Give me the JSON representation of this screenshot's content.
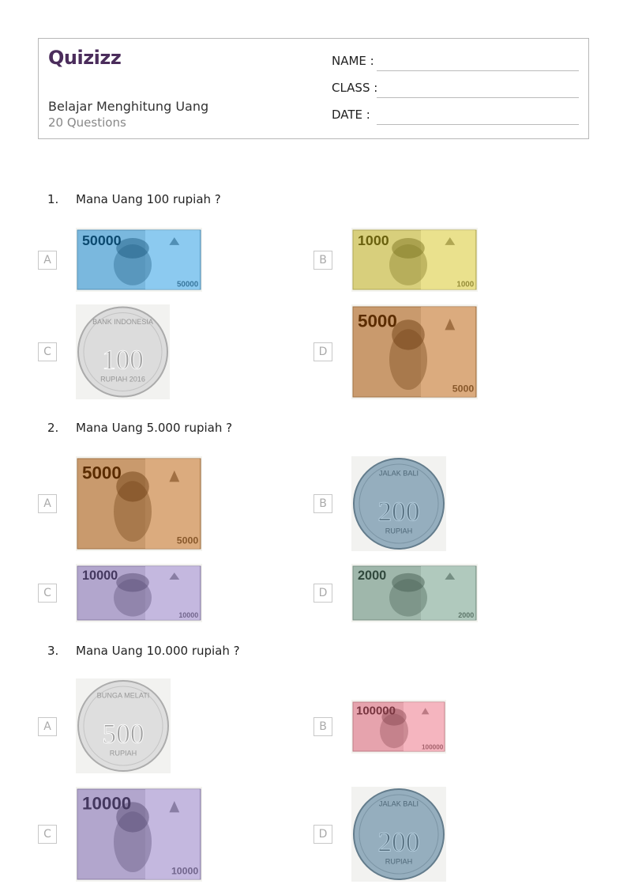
{
  "header": {
    "logo": "Quizizz",
    "title": "Belajar Menghitung Uang",
    "subtitle": "20 Questions",
    "fields": {
      "name": "NAME :",
      "class": "CLASS :",
      "date": "DATE  :"
    }
  },
  "questions": [
    {
      "number": "1.",
      "text": "Mana Uang 100 rupiah ?",
      "options": [
        {
          "letter": "A",
          "item": {
            "kind": "note",
            "denom": "50000",
            "color": "#7ab8de"
          }
        },
        {
          "letter": "B",
          "item": {
            "kind": "note",
            "denom": "1000",
            "color": "#d8cf7c"
          }
        },
        {
          "letter": "C",
          "item": {
            "kind": "coin",
            "top": "BANK INDONESIA",
            "denom": "100",
            "bottom": "RUPIAH 2016",
            "color": "#dcdcdc"
          }
        },
        {
          "letter": "D",
          "item": {
            "kind": "note",
            "denom": "5000",
            "color": "#c99a6d"
          }
        }
      ]
    },
    {
      "number": "2.",
      "text": "Mana Uang 5.000 rupiah ?",
      "options": [
        {
          "letter": "A",
          "item": {
            "kind": "note",
            "denom": "5000",
            "color": "#c99a6d"
          }
        },
        {
          "letter": "B",
          "item": {
            "kind": "coin",
            "top": "JALAK BALI",
            "denom": "200",
            "bottom": "RUPIAH",
            "color": "#95aebe"
          }
        },
        {
          "letter": "C",
          "item": {
            "kind": "note",
            "denom": "10000",
            "color": "#b2a6cd"
          }
        },
        {
          "letter": "D",
          "item": {
            "kind": "note",
            "denom": "2000",
            "color": "#9fb7ab"
          }
        }
      ]
    },
    {
      "number": "3.",
      "text": "Mana Uang 10.000 rupiah ?",
      "options": [
        {
          "letter": "A",
          "item": {
            "kind": "coin",
            "top": "BUNGA MELATI",
            "denom": "500",
            "bottom": "RUPIAH",
            "color": "#dedede"
          }
        },
        {
          "letter": "B",
          "item": {
            "kind": "note",
            "denom": "100000",
            "color": "#e6a3ad"
          }
        },
        {
          "letter": "C",
          "item": {
            "kind": "note",
            "denom": "10000",
            "color": "#b2a6cd"
          }
        },
        {
          "letter": "D",
          "item": {
            "kind": "coin",
            "top": "JALAK BALI",
            "denom": "200",
            "bottom": "RUPIAH",
            "color": "#95aebe"
          }
        }
      ]
    }
  ]
}
